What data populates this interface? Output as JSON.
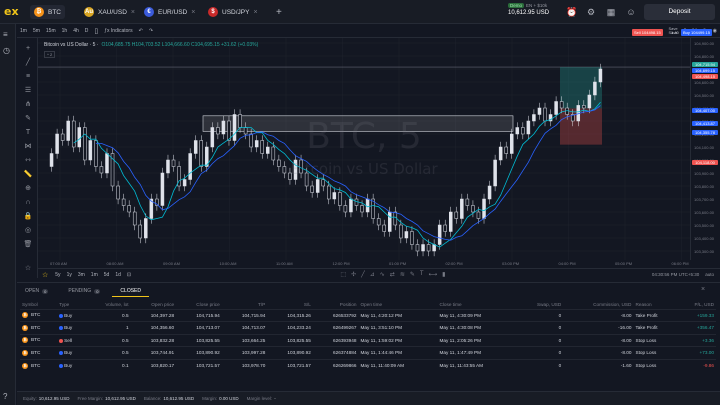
{
  "header": {
    "logo": "ex",
    "tabs": [
      {
        "label": "BTC",
        "icon": "bitcoin-icon",
        "color": "#f7931a",
        "active": true
      },
      {
        "label": "XAU/USD",
        "icon": "gold-icon",
        "color": "#d9a521"
      },
      {
        "label": "EUR/USD",
        "icon": "eur-flag-icon",
        "color": "#3b5bdb"
      },
      {
        "label": "USD/JPY",
        "icon": "usd-flag-icon",
        "color": "#c92a2a"
      }
    ],
    "add_tab": "+",
    "account_badge": "Demo",
    "account_name": "EN + ​$10k",
    "balance": "10,612.95 USD",
    "deposit_label": "Deposit"
  },
  "toolbar": {
    "timeframes": [
      "1m",
      "5m",
      "15m",
      "1h",
      "4h",
      "D"
    ],
    "indicators_label": "Indicators",
    "save_label": "Save",
    "save_sub": "Save"
  },
  "trade_buttons": {
    "sell_label": "Sell 104498.15",
    "spread": "1.40",
    "buy_label": "Buy 104499.15"
  },
  "legend": {
    "title": "Bitcoin vs US Dollar · 5 ·",
    "ohlc": "O104,685.75  H104,703.52  L104,666.60  C104,695.15 +31.62 (+0.03%)",
    "collapse": "^ 2"
  },
  "watermark": {
    "symbol": "BTC, 5",
    "name": "Bitcoin vs US Dollar"
  },
  "price_axis": {
    "labels": [
      "104,900.00",
      "104,800.00",
      "104,700.00",
      "104,600.00",
      "104,500.00",
      "104,400.00",
      "104,300.00",
      "104,200.00",
      "104,100.00",
      "104,000.00",
      "103,900.00",
      "103,800.00",
      "103,700.00",
      "103,600.00",
      "103,500.00",
      "103,400.00",
      "103,300.00"
    ],
    "tags": [
      {
        "label": "104,715.94",
        "color": "#26a69a"
      },
      {
        "label": "104,699.15",
        "color": "#2962ff"
      },
      {
        "label": "104,498.15",
        "color": "#ef5350"
      },
      {
        "label": "104,407.00",
        "color": "#2962ff"
      },
      {
        "label": "104,413.87",
        "color": "#2962ff"
      },
      {
        "label": "104,355.78",
        "color": "#2962ff"
      },
      {
        "label": "104,118.00",
        "color": "#ef5350"
      }
    ]
  },
  "time_axis": {
    "labels": [
      "07:00 AM",
      "08:00 AM",
      "09:00 AM",
      "10:00 AM",
      "11:00 AM",
      "12:00 PM",
      "01:00 PM",
      "02:00 PM",
      "03:00 PM",
      "04:00 PM",
      "05:00 PM",
      "06:00 PM"
    ]
  },
  "range_bar": {
    "ranges": [
      "5y",
      "1y",
      "3m",
      "1m",
      "5d",
      "1d"
    ],
    "clock": "04:30:56 PM UTC+5:30",
    "auto": "auto"
  },
  "panel": {
    "tabs": [
      {
        "label": "OPEN",
        "count": "0"
      },
      {
        "label": "PENDING",
        "count": "0"
      },
      {
        "label": "CLOSED",
        "count": ""
      }
    ],
    "columns": [
      "Symbol",
      "Type",
      "Volume, lot",
      "Open price",
      "Close price",
      "T/P",
      "S/L",
      "Position",
      "Open time",
      "Close time",
      "Swap, USD",
      "Commission, USD",
      "Reason",
      "P/L, USD"
    ],
    "rows": [
      {
        "symbol": "BTC",
        "type": "Buy",
        "volume": "0.5",
        "open": "104,397.28",
        "close": "104,715.94",
        "tp": "104,715.94",
        "sl": "104,315.26",
        "position": "626533792",
        "open_time": "May 11, 4:20:12 PM",
        "close_time": "May 11, 4:30:09 PM",
        "swap": "0",
        "commission": "-8.00",
        "reason": "Take Profit",
        "pl": "+159.33",
        "dir": "buy"
      },
      {
        "symbol": "BTC",
        "type": "Buy",
        "volume": "1",
        "open": "104,356.60",
        "close": "104,713.07",
        "tp": "104,713.07",
        "sl": "104,233.24",
        "position": "626499267",
        "open_time": "May 11, 3:51:10 PM",
        "close_time": "May 11, 4:30:08 PM",
        "swap": "0",
        "commission": "-16.00",
        "reason": "Take Profit",
        "pl": "+356.47",
        "dir": "buy"
      },
      {
        "symbol": "BTC",
        "type": "Sell",
        "volume": "0.5",
        "open": "103,832.28",
        "close": "103,825.55",
        "tp": "103,664.25",
        "sl": "103,825.55",
        "position": "626393948",
        "open_time": "May 11, 1:59:02 PM",
        "close_time": "May 11, 2:05:26 PM",
        "swap": "0",
        "commission": "-8.00",
        "reason": "Stop Loss",
        "pl": "+3.36",
        "dir": "sell"
      },
      {
        "symbol": "BTC",
        "type": "Buy",
        "volume": "0.5",
        "open": "103,744.91",
        "close": "103,890.92",
        "tp": "103,997.28",
        "sl": "103,890.92",
        "position": "626374884",
        "open_time": "May 11, 1:44:46 PM",
        "close_time": "May 11, 1:47:49 PM",
        "swap": "0",
        "commission": "-8.00",
        "reason": "Stop Loss",
        "pl": "+73.00",
        "dir": "buy"
      },
      {
        "symbol": "BTC",
        "type": "Buy",
        "volume": "0.1",
        "open": "103,820.17",
        "close": "103,721.57",
        "tp": "103,978.70",
        "sl": "103,721.57",
        "position": "626269866",
        "open_time": "May 11, 11:40:09 AM",
        "close_time": "May 11, 11:43:55 AM",
        "swap": "0",
        "commission": "-1.60",
        "reason": "Stop Loss",
        "pl": "-9.86",
        "dir": "buy"
      }
    ]
  },
  "footer": {
    "equity_label": "Equity:",
    "equity": "10,612.95 USD",
    "free_margin_label": "Free Margin:",
    "free_margin": "10,612.95 USD",
    "balance_label": "Balance:",
    "balance": "10,612.95 USD",
    "margin_label": "Margin:",
    "margin": "0.00 USD",
    "margin_level_label": "Margin level:",
    "margin_level": "-"
  },
  "colors": {
    "up": "#26a69a",
    "down": "#ef5350",
    "accent": "#f0c419",
    "ma1": "#2962ff",
    "ma2": "#00bcd4"
  }
}
